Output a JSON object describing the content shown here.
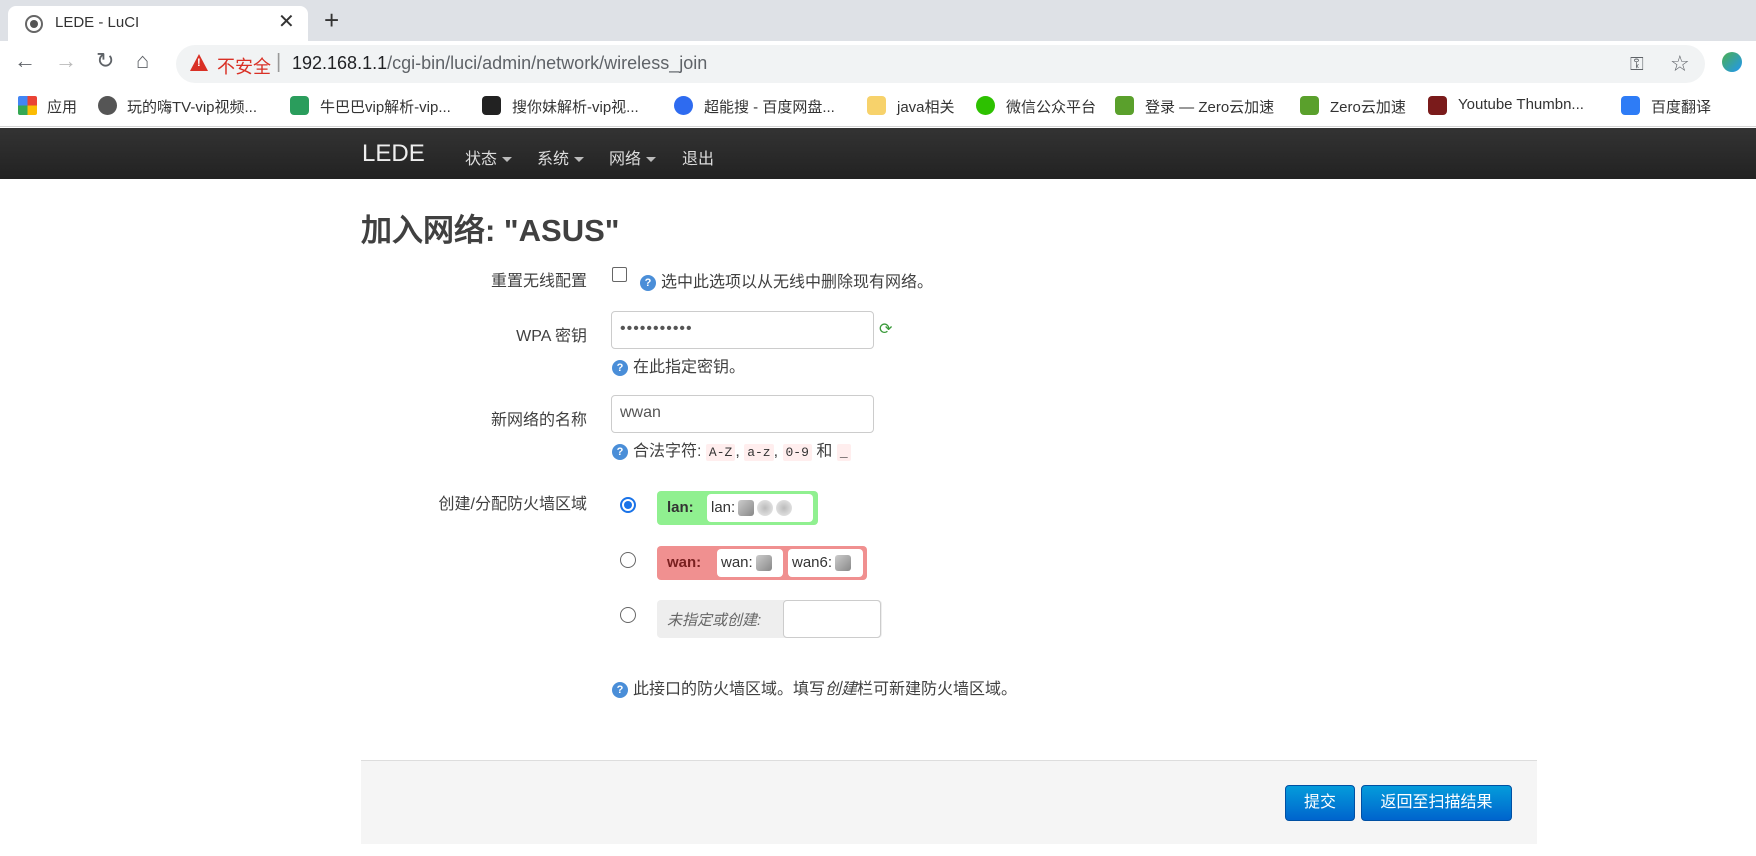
{
  "browser": {
    "tab_title": "LEDE - LuCI",
    "close_glyph": "✕",
    "newtab_glyph": "+",
    "insecure_label": "不安全",
    "separator": "|",
    "url_host": "192.168.1.1",
    "url_path": "/cgi-bin/luci/admin/network/wireless_join",
    "bookmarks": [
      {
        "label": "应用",
        "icon": "apps-icon"
      },
      {
        "label": "玩的嗨TV-vip视频...",
        "icon": "globe-icon"
      },
      {
        "label": "牛巴巴vip解析-vip...",
        "icon": "play-icon"
      },
      {
        "label": "搜你妹解析-vip视...",
        "icon": "crown-icon"
      },
      {
        "label": "超能搜 - 百度网盘...",
        "icon": "search-icon"
      },
      {
        "label": "java相关",
        "icon": "folder-icon"
      },
      {
        "label": "微信公众平台",
        "icon": "wechat-icon"
      },
      {
        "label": "登录 — Zero云加速",
        "icon": "star-icon"
      },
      {
        "label": "Zero云加速",
        "icon": "star-icon"
      },
      {
        "label": "Youtube Thumbn...",
        "icon": "yt-icon"
      },
      {
        "label": "百度翻译",
        "icon": "translate-icon"
      }
    ]
  },
  "header": {
    "brand": "LEDE",
    "menus": [
      "状态",
      "系统",
      "网络",
      "退出"
    ]
  },
  "page": {
    "title": "加入网络: \"ASUS\"",
    "reset_label": "重置无线配置",
    "reset_help": "选中此选项以从无线中删除现有网络。",
    "wpa_label": "WPA 密钥",
    "wpa_value": "•••••••••••",
    "wpa_help": "在此指定密钥。",
    "netname_label": "新网络的名称",
    "netname_value": "wwan",
    "netname_help_prefix": "合法字符:",
    "netname_tokens": [
      "A-Z",
      "a-z",
      "0-9",
      "_"
    ],
    "netname_and": "和",
    "zone_label": "创建/分配防火墙区域",
    "zones": [
      {
        "name": "lan:",
        "ifaces": [
          "lan:"
        ],
        "color": "#90f090",
        "selected": true
      },
      {
        "name": "wan:",
        "ifaces": [
          "wan:",
          "wan6:"
        ],
        "color": "#f09090",
        "selected": false
      }
    ],
    "unspecified_label": "未指定或创建:",
    "zone_help_1": "此接口的防火墙区域。填写",
    "zone_help_em": "创建",
    "zone_help_2": "栏可新建防火墙区域。",
    "help_glyph": "?",
    "submit_label": "提交",
    "back_label": "返回至扫描结果"
  }
}
